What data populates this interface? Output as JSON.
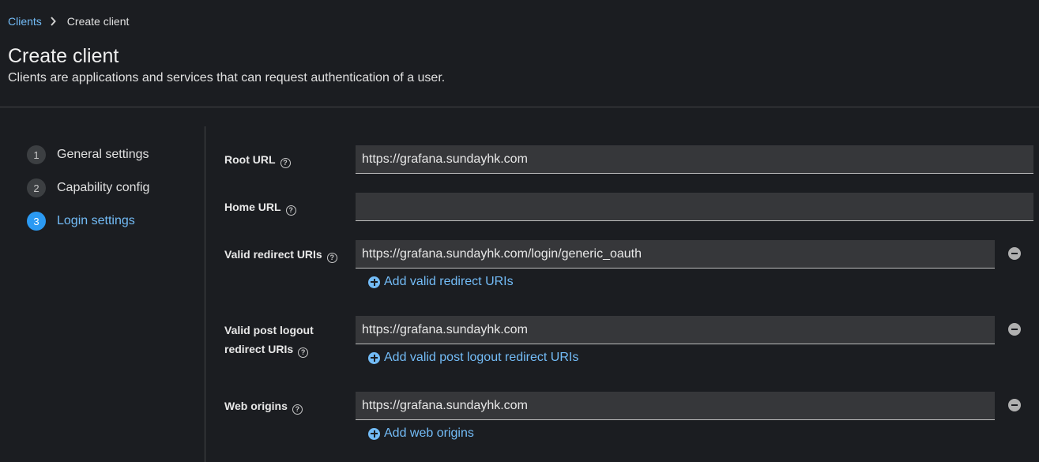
{
  "breadcrumb": {
    "parent": "Clients",
    "current": "Create client"
  },
  "header": {
    "title": "Create client",
    "subtitle": "Clients are applications and services that can request authentication of a user."
  },
  "steps": [
    {
      "number": "1",
      "label": "General settings",
      "active": false
    },
    {
      "number": "2",
      "label": "Capability config",
      "active": false
    },
    {
      "number": "3",
      "label": "Login settings",
      "active": true
    }
  ],
  "form": {
    "root_url": {
      "label": "Root URL",
      "value": "https://grafana.sundayhk.com"
    },
    "home_url": {
      "label": "Home URL",
      "value": ""
    },
    "valid_redirect": {
      "label": "Valid redirect URIs",
      "value": "https://grafana.sundayhk.com/login/generic_oauth",
      "add_label": "Add valid redirect URIs"
    },
    "post_logout": {
      "label_line1": "Valid post logout",
      "label_line2": "redirect URIs",
      "value": "https://grafana.sundayhk.com",
      "add_label": "Add valid post logout redirect URIs"
    },
    "web_origins": {
      "label": "Web origins",
      "value": "https://grafana.sundayhk.com",
      "add_label": "Add web origins"
    }
  },
  "colors": {
    "background": "#1b1d21",
    "link": "#73bcf7",
    "active_step": "#2b9af3"
  }
}
